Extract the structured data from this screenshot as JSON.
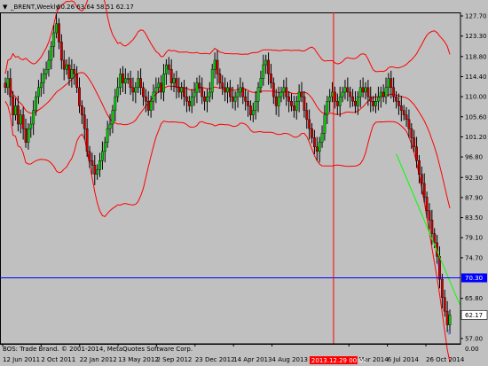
{
  "header": {
    "dropdown_glyph": "▼",
    "title": "_BRENT,Weekly",
    "ohlc": "60.26 63.64 58.51 62.17"
  },
  "price_axis": {
    "labels": [
      "127.70",
      "123.30",
      "118.80",
      "114.40",
      "110.00",
      "105.60",
      "101.20",
      "96.80",
      "92.30",
      "87.90",
      "83.50",
      "79.10",
      "74.70",
      "70.30",
      "65.80",
      "62.17",
      "57.00"
    ],
    "label_values": [
      127.7,
      123.3,
      118.8,
      114.4,
      110.0,
      105.6,
      101.2,
      96.8,
      92.3,
      87.9,
      83.5,
      79.1,
      74.7,
      70.3,
      65.8,
      62.17,
      57.0
    ],
    "top_value": 127.7,
    "bottom_value": 57.0
  },
  "time_axis": {
    "labels": [
      "12 Jun 2011",
      "2 Oct 2011",
      "22 Jan 2012",
      "13 May 2012",
      "2 Sep 2012",
      "23 Dec 2012",
      "14 Apr 2013",
      "4 Aug 2013",
      "2013.12.29 00:00",
      "16 Mar 2014",
      "6 Jul 2014",
      "26 Oct 2014"
    ]
  },
  "hline": {
    "value": 70.3,
    "label": "70.30",
    "color": "#0000ff"
  },
  "current_price": {
    "value": 62.17,
    "label": "62.17"
  },
  "crosshair": {
    "label": "2013.12.29 00:00",
    "color": "#ff0000"
  },
  "footer": {
    "copyright": "BOS: Trade Brand. © 2001-2014, MetaQuotes Software Corp.",
    "subindicator_value": "0.00"
  },
  "colors": {
    "background": "#c0c0c0",
    "bull": "#00cc00",
    "bear": "#cc0000",
    "bands": "#ff0000",
    "trend": "#00ff00",
    "grid_text": "#000000"
  },
  "chart_data": {
    "type": "candlestick",
    "title": "_BRENT,Weekly",
    "ylim": [
      57.0,
      127.7
    ],
    "closes": [
      112,
      114,
      110,
      106,
      108,
      104,
      106,
      103,
      100,
      103,
      104,
      107,
      110,
      112,
      113,
      115,
      116,
      118,
      121,
      124,
      126,
      122,
      118,
      116,
      117,
      114,
      116,
      115,
      112,
      108,
      106,
      103,
      98,
      96,
      95,
      93,
      94,
      96,
      98,
      100,
      103,
      104,
      107,
      110,
      112,
      115,
      113,
      114,
      114,
      112,
      111,
      112,
      114,
      112,
      110,
      109,
      107,
      109,
      111,
      112,
      113,
      111,
      115,
      117,
      116,
      113,
      114,
      112,
      111,
      112,
      110,
      109,
      108,
      110,
      111,
      113,
      112,
      110,
      109,
      110,
      111,
      116,
      118,
      115,
      113,
      112,
      111,
      112,
      110,
      109,
      110,
      111,
      112,
      110,
      109,
      108,
      106,
      107,
      109,
      112,
      114,
      117,
      118,
      115,
      113,
      110,
      108,
      110,
      111,
      112,
      110,
      109,
      108,
      107,
      109,
      111,
      110,
      107,
      105,
      103,
      101,
      99,
      98,
      100,
      102,
      106,
      109,
      110,
      111,
      109,
      108,
      110,
      111,
      112,
      111,
      110,
      109,
      108,
      110,
      112,
      111,
      112,
      110,
      109,
      108,
      109,
      110,
      111,
      110,
      112,
      114,
      112,
      110,
      109,
      108,
      107,
      106,
      105,
      103,
      101,
      99,
      96,
      93,
      91,
      88,
      85,
      83,
      80,
      78,
      75,
      70,
      66,
      63,
      60,
      62.17
    ],
    "upper_band_from_index": 0,
    "markers": [
      {
        "type": "arrow-up",
        "value": 73.5
      },
      {
        "type": "arrow-down",
        "value": 58.5
      }
    ]
  }
}
